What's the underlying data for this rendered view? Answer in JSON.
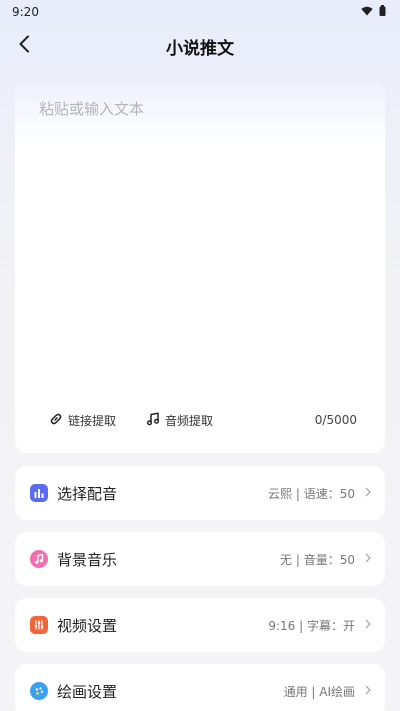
{
  "status_bar": {
    "time": "9:20"
  },
  "header": {
    "title": "小说推文"
  },
  "editor": {
    "placeholder": "粘贴或输入文本",
    "value": "",
    "link_extract_label": "链接提取",
    "audio_extract_label": "音频提取",
    "counter": "0/5000"
  },
  "settings": [
    {
      "label": "选择配音",
      "value": "云熙 | 语速：50",
      "icon": "bar-chart-icon",
      "color": "#5b6cf0"
    },
    {
      "label": "背景音乐",
      "value": "无 | 音量：50",
      "icon": "music-note-icon",
      "color": "#f06fb0"
    },
    {
      "label": "视频设置",
      "value": "9:16 | 字幕：开",
      "icon": "sliders-icon",
      "color": "#f2653a"
    },
    {
      "label": "绘画设置",
      "value": "通用 | AI绘画",
      "icon": "palette-icon",
      "color": "#3aa0f2"
    }
  ]
}
